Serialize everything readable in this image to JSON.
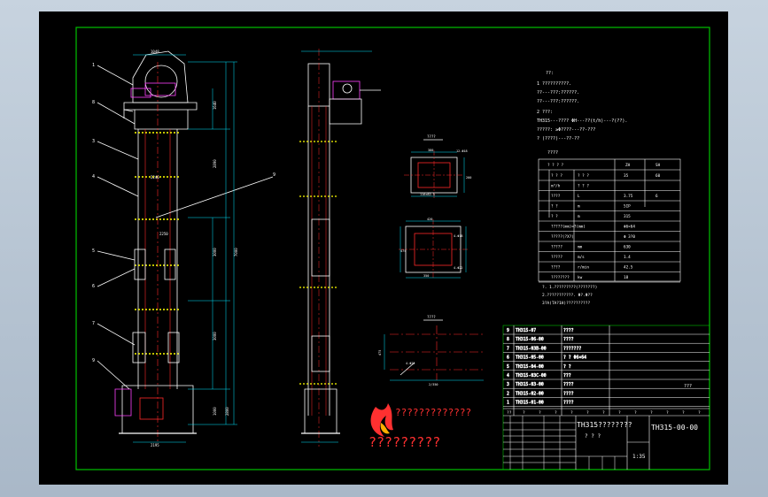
{
  "drawing": {
    "part_labels": [
      "1",
      "8",
      "3",
      "4",
      "9",
      "5",
      "6",
      "7",
      "9"
    ],
    "dims_main": [
      "1048",
      "1640",
      "2890",
      "3000",
      "7000",
      "3000",
      "1000",
      "2800",
      "2195",
      "2250",
      "2246",
      "4",
      "5",
      "1"
    ],
    "section_title": "????",
    "section_a_dims": [
      "380",
      "12-Φ18",
      "200",
      "116×82.5"
    ],
    "section_b_dims": [
      "420",
      "475",
      "4-Φ18",
      "350",
      "4-Φ22"
    ],
    "bottom_view_title": "????",
    "bottom_view_dims": [
      "475",
      "4-Φ22",
      "2/350"
    ]
  },
  "notes": {
    "title": "??:",
    "lines": [
      "1  ??????????.",
      "   ??---???:??????.",
      "   ??---???:??????.",
      "2  ???:",
      "   TH315---???? ΦH---??(t/h)---?(??).",
      "   ?????:  ≥Φ????---??-???",
      "           ? (????)---??-??"
    ],
    "table_title": "????"
  },
  "spec_table": {
    "header": [
      "? ? ?  ?",
      "ZH",
      "SH"
    ],
    "rows": [
      [
        "? ? ?",
        "? ? ?",
        "35",
        "60"
      ],
      [
        "m³/h",
        "? ? ?",
        "",
        ""
      ],
      [
        "????",
        "L",
        "3.75",
        "6"
      ],
      [
        "?  ?",
        "m",
        "5IP",
        ""
      ],
      [
        "?  ?",
        "m",
        "315",
        ""
      ],
      [
        "?????(mm)×?(mm)",
        "",
        "Φ6×64",
        ""
      ],
      [
        "?????(?X?)",
        "",
        "Φ 3?0",
        ""
      ],
      [
        "?????",
        "mm",
        "630",
        ""
      ],
      [
        "?????",
        "m/s",
        "1.4",
        ""
      ],
      [
        "????",
        "r/min",
        "42.5",
        ""
      ],
      [
        "????????",
        "kw",
        "18",
        ""
      ]
    ],
    "footnotes": [
      "?. 1.?????????(???????)",
      "   2.???????????.   Φ?.Φ??",
      "   3?A)TA?1H)??????????"
    ]
  },
  "title_block": {
    "parts": [
      {
        "no": "9",
        "code": "TH315-07",
        "name": "????"
      },
      {
        "no": "8",
        "code": "TH315-06-00",
        "name": "????"
      },
      {
        "no": "7",
        "code": "TH315-03B-00",
        "name": "???????"
      },
      {
        "no": "6",
        "code": "TH315-05-00",
        "name": "?  ?  Φ6×64"
      },
      {
        "no": "5",
        "code": "TH315-04-00",
        "name": "?  ?"
      },
      {
        "no": "4",
        "code": "TH315-03C-00",
        "name": "???"
      },
      {
        "no": "3",
        "code": "TH315-03-00",
        "name": "????"
      },
      {
        "no": "2",
        "code": "TH315-02-00",
        "name": "????"
      },
      {
        "no": "1",
        "code": "TH315-01-00",
        "name": "????"
      }
    ],
    "header_row": [
      "??",
      "?",
      "?",
      "?",
      "?",
      "?",
      "?",
      "?",
      "?",
      "?",
      "?",
      "?",
      "?"
    ],
    "drawing_name": "TH315????????",
    "drawing_sub": "?    ?    ?",
    "drawing_code": "TH315-00-00",
    "scale": "1:35",
    "extra": "???"
  },
  "logo": {
    "text_line1": "?????????????",
    "text_line2": "?????????"
  },
  "colors": {
    "background": "#000000",
    "border": "#00c000",
    "lines": "#ffffff",
    "accent_red": "#ff2a2a",
    "accent_yellow": "#ffff00",
    "accent_cyan": "#00e5ff",
    "accent_green": "#33ff33",
    "accent_magenta": "#ff40ff",
    "logo_red": "#ff3030"
  }
}
